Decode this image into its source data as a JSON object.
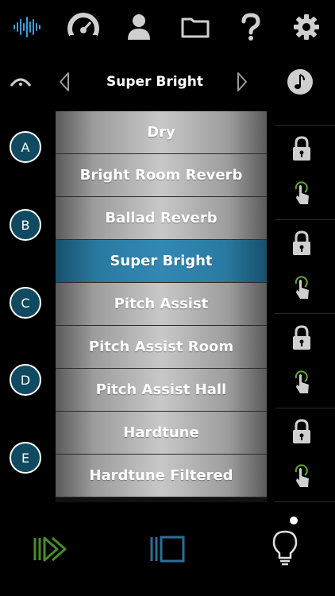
{
  "header": {
    "current_preset": "Super Bright"
  },
  "toolbar": {
    "icons": [
      "waveform-icon",
      "gauge-icon",
      "user-icon",
      "folder-icon",
      "help-icon",
      "settings-icon"
    ]
  },
  "preset_list": {
    "items": [
      {
        "label": "Dry",
        "selected": false
      },
      {
        "label": "Bright Room Reverb",
        "selected": false
      },
      {
        "label": "Ballad Reverb",
        "selected": false
      },
      {
        "label": "Super Bright",
        "selected": true
      },
      {
        "label": "Pitch Assist",
        "selected": false
      },
      {
        "label": "Pitch Assist Room",
        "selected": false
      },
      {
        "label": "Pitch Assist Hall",
        "selected": false
      },
      {
        "label": "Hardtune",
        "selected": false
      },
      {
        "label": "Hardtune Filtered",
        "selected": false
      }
    ]
  },
  "slots": {
    "labels": [
      "A",
      "B",
      "C",
      "D",
      "E"
    ]
  },
  "colors": {
    "accent": "#3189b4",
    "slot_fill": "#0f4a60",
    "green": "#4a8a2a",
    "blue": "#2b6f96"
  }
}
